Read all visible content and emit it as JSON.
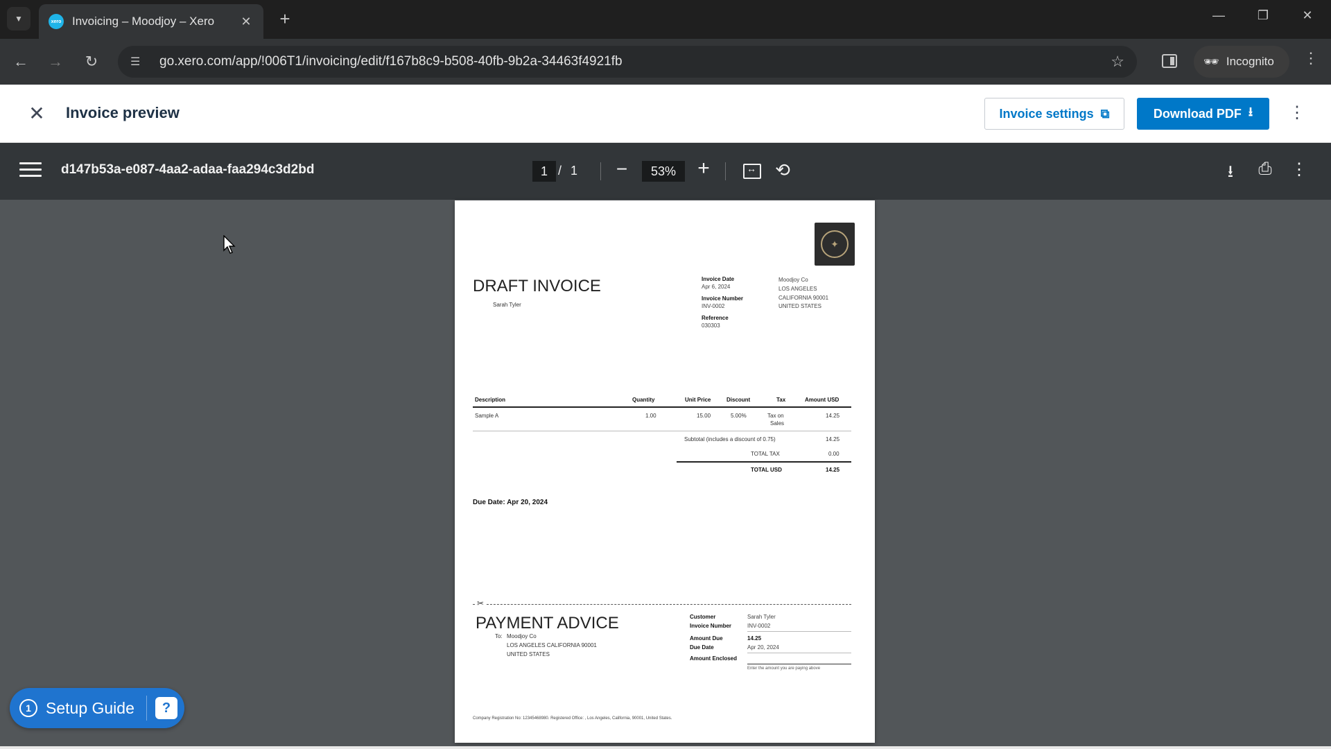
{
  "browser": {
    "tab_title": "Invoicing – Moodjoy – Xero",
    "tab_favicon_text": "xero",
    "url": "go.xero.com/app/!006T1/invoicing/edit/f167b8c9-b508-40fb-9b2a-34463f4921fb",
    "incognito_label": "Incognito"
  },
  "header": {
    "title": "Invoice preview",
    "invoice_settings_label": "Invoice settings",
    "download_pdf_label": "Download PDF"
  },
  "pdf_toolbar": {
    "file_name": "d147b53a-e087-4aa2-adaa-faa294c3d2bd",
    "current_page": "1",
    "page_separator": "/",
    "total_pages": "1",
    "zoom": "53%"
  },
  "invoice": {
    "title": "DRAFT INVOICE",
    "bill_to": "Sarah Tyler",
    "invoice_date_label": "Invoice Date",
    "invoice_date": "Apr 6, 2024",
    "invoice_number_label": "Invoice Number",
    "invoice_number": "INV-0002",
    "reference_label": "Reference",
    "reference": "030303",
    "company_address": [
      "Moodjoy Co",
      "LOS ANGELES",
      "CALIFORNIA 90001",
      "UNITED STATES"
    ],
    "columns": [
      "Description",
      "Quantity",
      "Unit Price",
      "Discount",
      "Tax",
      "Amount USD"
    ],
    "line_item": {
      "description": "Sample A",
      "quantity": "1.00",
      "unit_price": "15.00",
      "discount": "5.00%",
      "tax_line1": "Tax on",
      "tax_line2": "Sales",
      "amount": "14.25"
    },
    "subtotal_label": "Subtotal (includes a discount of 0.75)",
    "subtotal": "14.25",
    "total_tax_label": "TOTAL TAX",
    "total_tax": "0.00",
    "total_label": "TOTAL USD",
    "total": "14.25",
    "due_date_text": "Due Date: Apr 20, 2024"
  },
  "payment_advice": {
    "title": "PAYMENT ADVICE",
    "to_label": "To:",
    "to_lines": [
      "Moodjoy Co",
      "LOS ANGELES CALIFORNIA 90001",
      "UNITED STATES"
    ],
    "customer_label": "Customer",
    "customer": "Sarah Tyler",
    "invoice_number_label": "Invoice Number",
    "invoice_number": "INV-0002",
    "amount_due_label": "Amount Due",
    "amount_due": "14.25",
    "due_date_label": "Due Date",
    "due_date": "Apr 20, 2024",
    "amount_enclosed_label": "Amount Enclosed",
    "amount_enclosed_hint": "Enter the amount you are paying above"
  },
  "footer": {
    "registration": "Company Registration No: 12345468980. Registered Office: , Los Angeles, California, 90001, United States."
  },
  "setup_guide": {
    "count": "1",
    "label": "Setup Guide"
  }
}
